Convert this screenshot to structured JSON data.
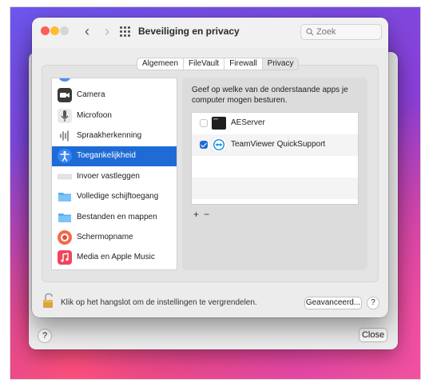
{
  "window": {
    "title": "Beveiliging en privacy",
    "search_placeholder": "Zoek"
  },
  "tabs": [
    {
      "label": "Algemeen",
      "active": false
    },
    {
      "label": "FileVault",
      "active": false
    },
    {
      "label": "Firewall",
      "active": false
    },
    {
      "label": "Privacy",
      "active": true
    }
  ],
  "sidebar": {
    "items": [
      {
        "label": "Camera",
        "icon": "camera-icon"
      },
      {
        "label": "Microfoon",
        "icon": "microphone-icon"
      },
      {
        "label": "Spraakherkenning",
        "icon": "waveform-icon"
      },
      {
        "label": "Toegankelijkheid",
        "icon": "accessibility-icon",
        "selected": true
      },
      {
        "label": "Invoer vastleggen",
        "icon": "keyboard-icon"
      },
      {
        "label": "Volledige schijftoegang",
        "icon": "folder-icon"
      },
      {
        "label": "Bestanden en mappen",
        "icon": "folder-icon"
      },
      {
        "label": "Schermopname",
        "icon": "screen-record-icon"
      },
      {
        "label": "Media en Apple Music",
        "icon": "music-icon"
      }
    ]
  },
  "panel": {
    "description": "Geef op welke van de onderstaande apps je computer mogen besturen.",
    "apps": [
      {
        "name": "AEServer",
        "checked": false,
        "icon": "terminal-app-icon"
      },
      {
        "name": "TeamViewer QuickSupport",
        "checked": true,
        "icon": "teamviewer-icon"
      }
    ],
    "add_label": "+",
    "remove_label": "−"
  },
  "footer": {
    "lock_text": "Klik op het hangslot om de instellingen te vergrendelen.",
    "advanced_label": "Geavanceerd...",
    "help_label": "?"
  },
  "back_window": {
    "help_label": "?",
    "close_label": "Close"
  },
  "colors": {
    "selection": "#1f6bd6",
    "traffic_red": "#ff5f57",
    "traffic_yellow": "#febc2e"
  }
}
